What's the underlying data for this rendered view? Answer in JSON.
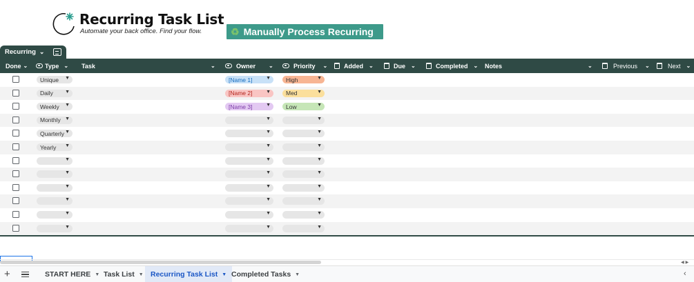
{
  "header": {
    "title": "Recurring Task List",
    "subtitle": "Automate your back office. Find your flow.",
    "process_button_label": "Manually Process Recurring"
  },
  "table": {
    "name": "Recurring",
    "columns": {
      "done": "Done",
      "type": "Type",
      "task": "Task",
      "owner": "Owner",
      "priority": "Priority",
      "added": "Added",
      "due": "Due",
      "completed": "Completed",
      "notes": "Notes",
      "previous": "Previous",
      "next": "Next"
    },
    "rows": [
      {
        "type": "Unique",
        "owner": "[Name 1]",
        "priority": "High",
        "owner_color": "blue",
        "priority_color": "orange",
        "checked": false
      },
      {
        "type": "Daily",
        "owner": "[Name 2]",
        "priority": "Med",
        "owner_color": "red",
        "priority_color": "yellow",
        "checked": false
      },
      {
        "type": "Weekly",
        "owner": "[Name 3]",
        "priority": "Low",
        "owner_color": "purple",
        "priority_color": "green",
        "checked": false
      },
      {
        "type": "Monthly",
        "owner": "",
        "priority": "",
        "checked": false
      },
      {
        "type": "Quarterly",
        "owner": "",
        "priority": "",
        "checked": false
      },
      {
        "type": "Yearly",
        "owner": "",
        "priority": "",
        "checked": false
      },
      {
        "type": "",
        "owner": "",
        "priority": "",
        "checked": false
      },
      {
        "type": "",
        "owner": "",
        "priority": "",
        "checked": false
      },
      {
        "type": "",
        "owner": "",
        "priority": "",
        "checked": false
      },
      {
        "type": "",
        "owner": "",
        "priority": "",
        "checked": false
      },
      {
        "type": "",
        "owner": "",
        "priority": "",
        "checked": false
      },
      {
        "type": "",
        "owner": "",
        "priority": "",
        "checked": false
      }
    ]
  },
  "sheet_tabs": [
    {
      "label": "START HERE",
      "active": false
    },
    {
      "label": "Task List",
      "active": false
    },
    {
      "label": "Recurring Task List",
      "active": true
    },
    {
      "label": "Completed Tasks",
      "active": false
    }
  ],
  "colors": {
    "header_bg": "#2f4a45",
    "button_bg": "#3d9a8a",
    "active_tab_bg": "#e1e9f7",
    "active_tab_text": "#1a56c5"
  }
}
